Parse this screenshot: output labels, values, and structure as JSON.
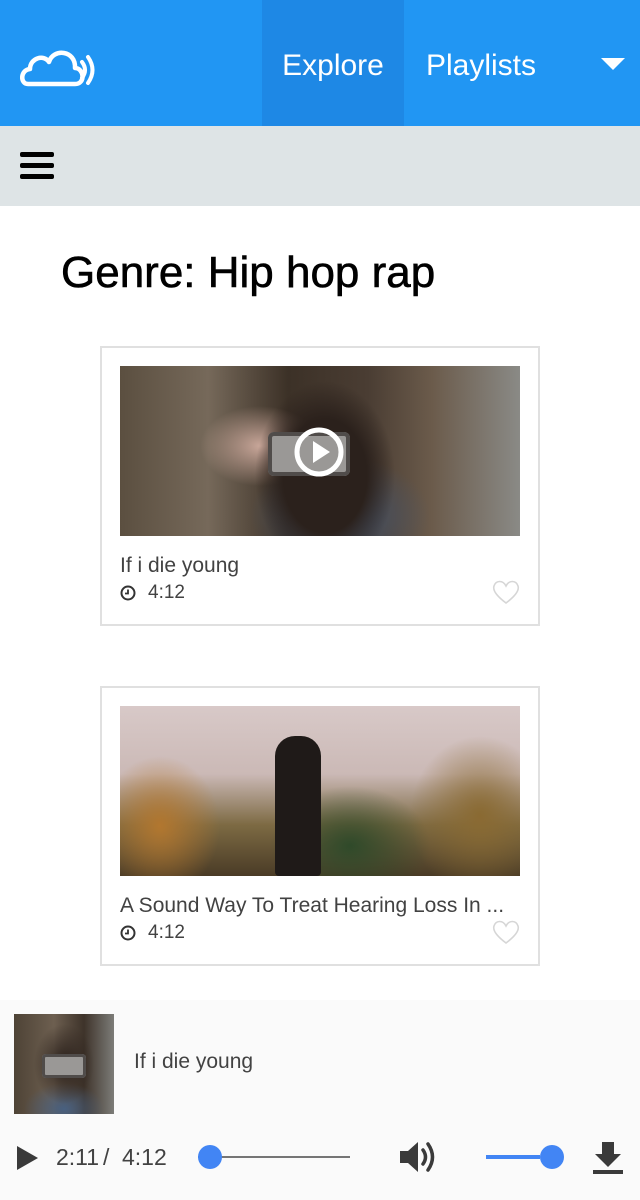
{
  "nav": {
    "logo_icon": "cloud-signal-icon",
    "explore_label": "Explore",
    "playlists_label": "Playlists",
    "dropdown_icon": "caret-down-icon",
    "menu_icon": "hamburger-menu-icon"
  },
  "page": {
    "title": "Genre: Hip hop rap"
  },
  "cards": [
    {
      "title": "If i die young",
      "duration": "4:12",
      "has_play_overlay": true,
      "favorite_icon": "heart-outline-icon"
    },
    {
      "title": "A Sound Way To Treat Hearing Loss In ...",
      "duration": "4:12",
      "has_play_overlay": false,
      "favorite_icon": "heart-outline-icon"
    }
  ],
  "player": {
    "title": "If i die young",
    "current_time": "2:11",
    "separator": "/",
    "total_time": "4:12",
    "seek_fraction": 0.0,
    "volume_fraction": 1.0,
    "play_icon": "play-icon",
    "volume_icon": "volume-icon",
    "download_icon": "download-icon"
  },
  "colors": {
    "header": "#2196f3",
    "active_tab": "#1e88e5",
    "menubar": "#dee4e6",
    "slider_accent": "#4285f4",
    "card_border": "#e0e0e0"
  }
}
